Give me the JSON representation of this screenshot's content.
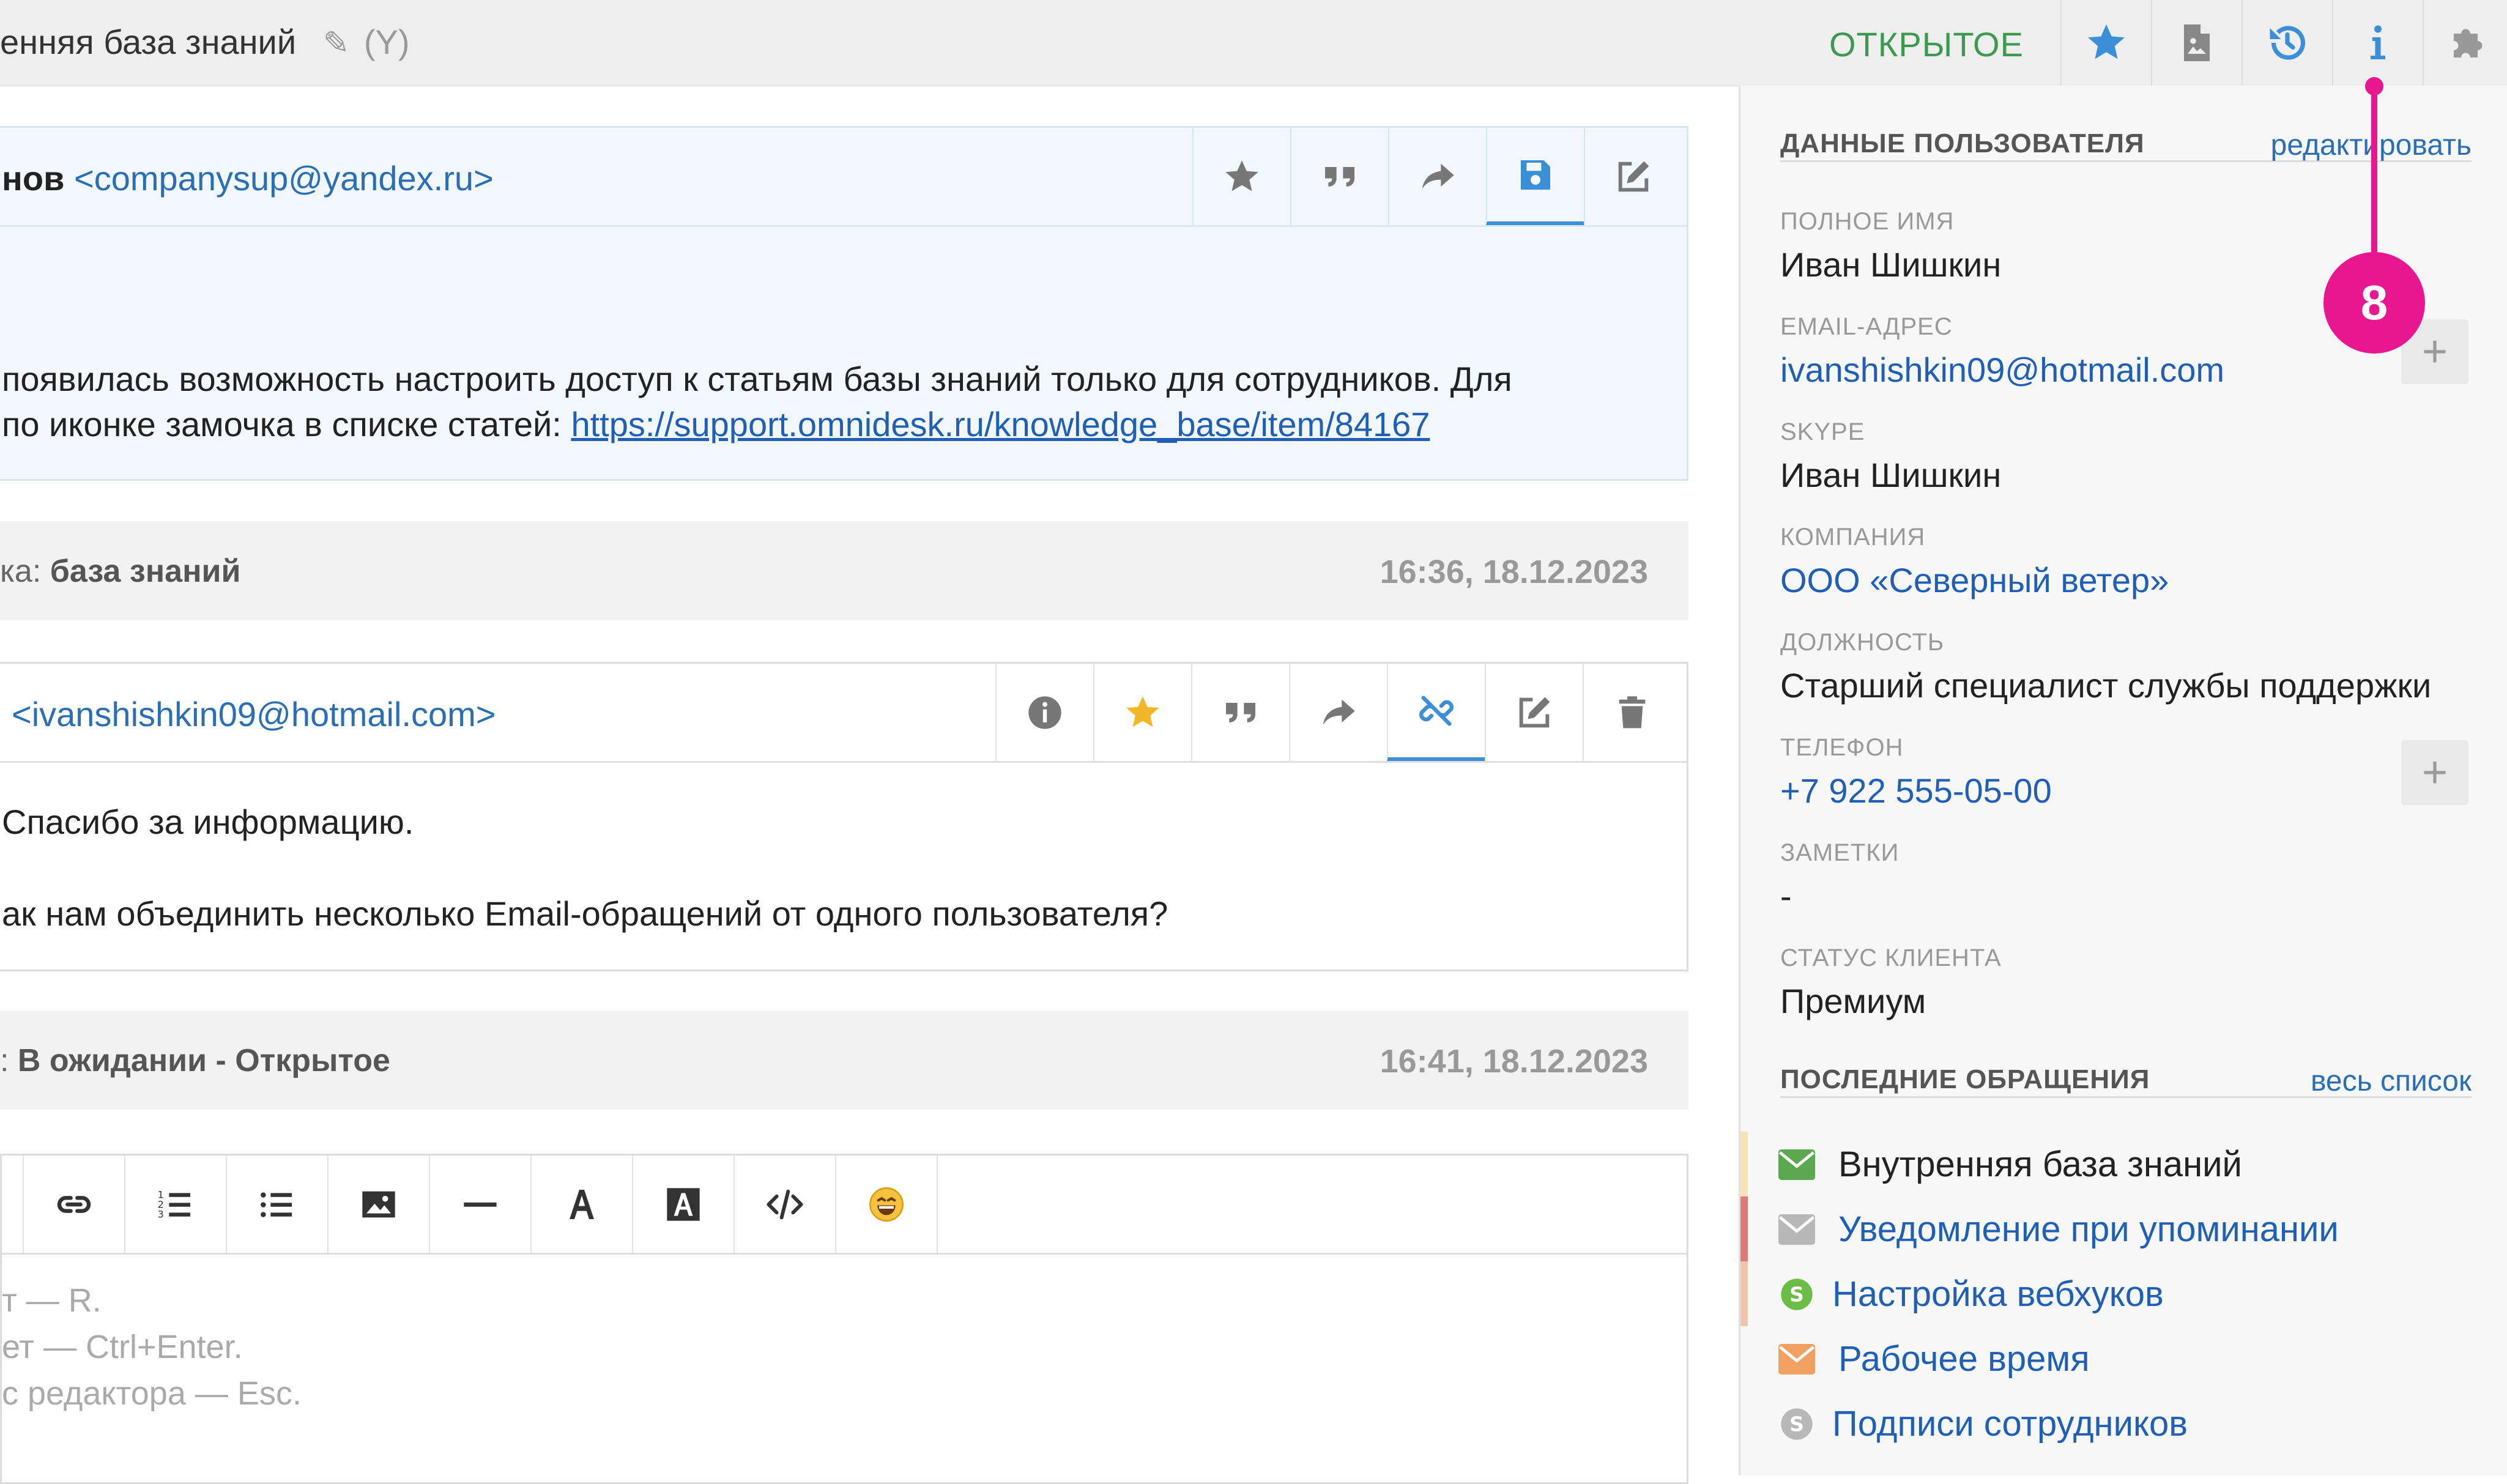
{
  "header": {
    "title": "енняя база знаний",
    "title_suffix": "(Y)",
    "status": "ОТКРЫТОЕ"
  },
  "message1": {
    "sender_name": "нов",
    "sender_email": "<companysup@yandex.ru>",
    "line1": "появилась возможность настроить доступ к статьям базы знаний только для сотрудников. Для",
    "line2_prefix": " по иконке замочка в списке статей: ",
    "link": "https://support.omnidesk.ru/knowledge_base/item/84167"
  },
  "event1": {
    "prefix": "ка: ",
    "value": "база знаний",
    "time": "16:36, 18.12.2023"
  },
  "message2": {
    "sender_email": "<ivanshishkin09@hotmail.com>",
    "line1": "Спасибо за информацию.",
    "line2": "ак нам объединить несколько Email-обращений от одного пользователя?"
  },
  "event2": {
    "prefix": ": ",
    "value": "В ожидании - Открытое",
    "time": "16:41, 18.12.2023"
  },
  "editor": {
    "hint1": "т — R.",
    "hint2": "ет — Ctrl+Enter.",
    "hint3": "с редактора — Esc."
  },
  "sidebar": {
    "user_section": {
      "title": "ДАННЫЕ ПОЛЬЗОВАТЕЛЯ",
      "link": "редактировать"
    },
    "fields": {
      "full_name": {
        "label": "ПОЛНОЕ ИМЯ",
        "value": "Иван Шишкин"
      },
      "email": {
        "label": "EMAIL-АДРЕС",
        "value": "ivanshishkin09@hotmail.com"
      },
      "skype": {
        "label": "SKYPE",
        "value": "Иван Шишкин"
      },
      "company": {
        "label": "КОМПАНИЯ",
        "value": "ООО «Северный ветер»"
      },
      "position": {
        "label": "ДОЛЖНОСТЬ",
        "value": "Старший специалист службы поддержки"
      },
      "phone": {
        "label": "ТЕЛЕФОН",
        "value": "+7 922 555-05-00"
      },
      "notes": {
        "label": "ЗАМЕТКИ",
        "value": "-"
      },
      "client_status": {
        "label": "СТАТУС КЛИЕНТА",
        "value": "Премиум"
      }
    },
    "recent_section": {
      "title": "ПОСЛЕДНИЕ ОБРАЩЕНИЯ",
      "link": "весь список"
    },
    "recent": [
      {
        "label": "Внутренняя база знаний",
        "channel": "email-icon",
        "icon_color": "#5aa84f",
        "bar_color": "#f6e2b8"
      },
      {
        "label": "Уведомление при упоминании",
        "channel": "email-icon",
        "icon_color": "#b8b8b8",
        "bar_color": "#e07a7a"
      },
      {
        "label": "Настройка вебхуков",
        "channel": "skype-icon",
        "icon_color": "#6cbd45",
        "bar_color": "#f2c3ad"
      },
      {
        "label": "Рабочее время",
        "channel": "email-icon",
        "icon_color": "#f0a060",
        "bar_color": ""
      },
      {
        "label": "Подписи сотрудников",
        "channel": "skype-icon",
        "icon_color": "#b8b8b8",
        "bar_color": ""
      }
    ]
  },
  "annotation": {
    "number": "8"
  },
  "colors": {
    "accent_blue": "#3b8fd9",
    "status_green": "#3c9a4e",
    "star_yellow": "#f2b82a",
    "annotation_pink": "#e8178f"
  }
}
